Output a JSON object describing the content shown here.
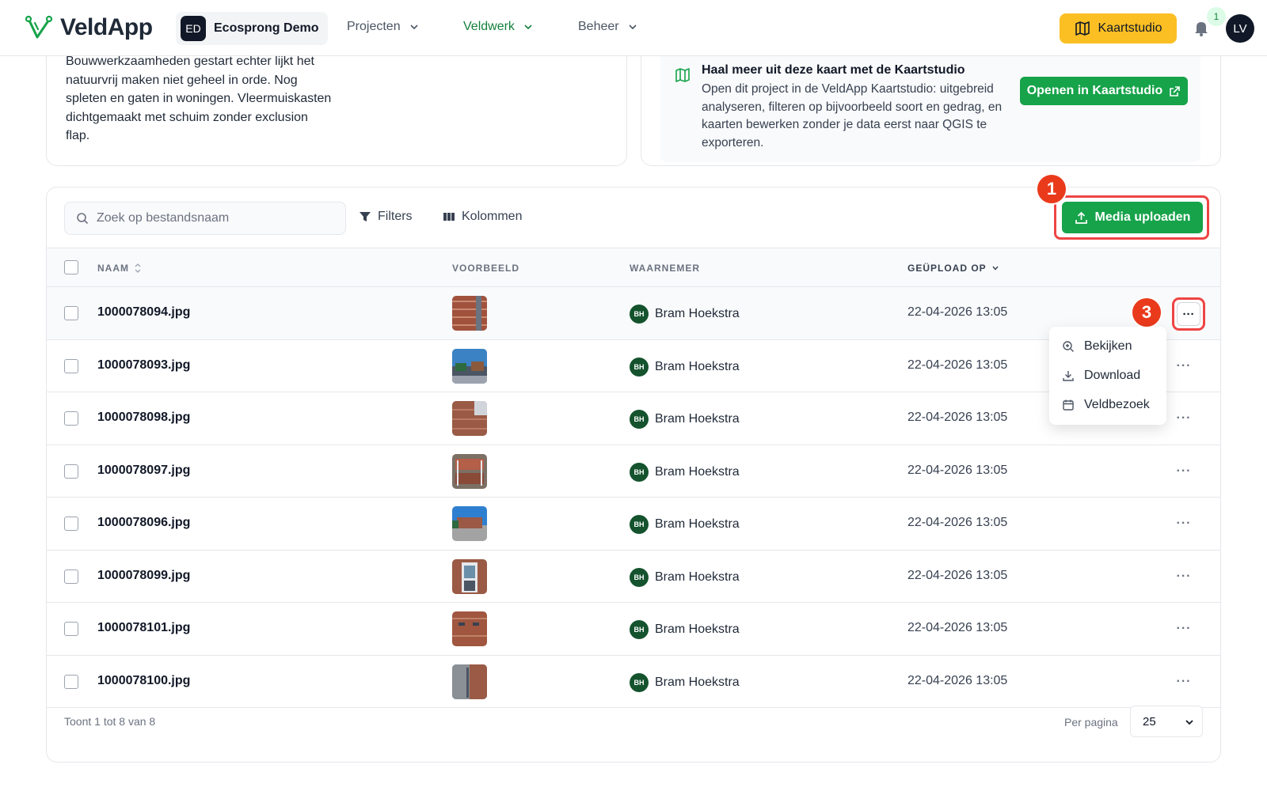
{
  "header": {
    "app_name": "VeldApp",
    "org_initials": "ED",
    "org_name": "Ecosprong Demo",
    "nav": [
      {
        "label": "Projecten",
        "active": false
      },
      {
        "label": "Veldwerk",
        "active": true
      },
      {
        "label": "Beheer",
        "active": false
      }
    ],
    "kaartstudio_label": "Kaartstudio",
    "notification_count": "1",
    "user_initials": "LV",
    "bell_icon": "bell-icon"
  },
  "notes_card": {
    "text": "Bouwwerkzaamheden gestart echter lijkt het natuurvrij maken niet geheel in orde. Nog spleten en gaten in woningen. Vleermuiskasten dichtgemaakt met schuim zonder exclusion flap."
  },
  "kaart_card": {
    "title": "Haal meer uit deze kaart met de Kaartstudio",
    "text": "Open dit project in de VeldApp Kaartstudio: uitgebreid analyseren, filteren op bijvoorbeeld soort en gedrag, en kaarten bewerken zonder je data eerst naar QGIS te exporteren.",
    "open_button": "Openen in Kaartstudio"
  },
  "media": {
    "search_placeholder": "Zoek op bestandsnaam",
    "filters_label": "Filters",
    "columns_label": "Kolommen",
    "upload_label": "Media uploaden",
    "step_upload": "1",
    "step_actions": "3",
    "columns": {
      "name": "NAAM",
      "preview": "VOORBEELD",
      "observer": "WAARNEMER",
      "uploaded": "GEÜPLOAD OP"
    },
    "rows": [
      {
        "name": "1000078094.jpg",
        "observer_initials": "BH",
        "observer": "Bram Hoekstra",
        "date": "22-04-2026 13:05"
      },
      {
        "name": "1000078093.jpg",
        "observer_initials": "BH",
        "observer": "Bram Hoekstra",
        "date": "22-04-2026 13:05"
      },
      {
        "name": "1000078098.jpg",
        "observer_initials": "BH",
        "observer": "Bram Hoekstra",
        "date": "22-04-2026 13:05"
      },
      {
        "name": "1000078097.jpg",
        "observer_initials": "BH",
        "observer": "Bram Hoekstra",
        "date": "22-04-2026 13:05"
      },
      {
        "name": "1000078096.jpg",
        "observer_initials": "BH",
        "observer": "Bram Hoekstra",
        "date": "22-04-2026 13:05"
      },
      {
        "name": "1000078099.jpg",
        "observer_initials": "BH",
        "observer": "Bram Hoekstra",
        "date": "22-04-2026 13:05"
      },
      {
        "name": "1000078101.jpg",
        "observer_initials": "BH",
        "observer": "Bram Hoekstra",
        "date": "22-04-2026 13:05"
      },
      {
        "name": "1000078100.jpg",
        "observer_initials": "BH",
        "observer": "Bram Hoekstra",
        "date": "22-04-2026 13:05"
      }
    ],
    "row_menu": [
      {
        "label": "Bekijken",
        "icon": "zoom-in-icon"
      },
      {
        "label": "Download",
        "icon": "download-icon"
      },
      {
        "label": "Veldbezoek",
        "icon": "calendar-icon"
      }
    ],
    "footer_text": "Toont 1 tot 8 van 8",
    "per_page_label": "Per pagina",
    "per_page_value": "25"
  },
  "colors": {
    "brand_green": "#16a34a",
    "accent_yellow": "#fbbf24",
    "highlight_red": "#ef4444",
    "avatar_green": "#14532d"
  }
}
